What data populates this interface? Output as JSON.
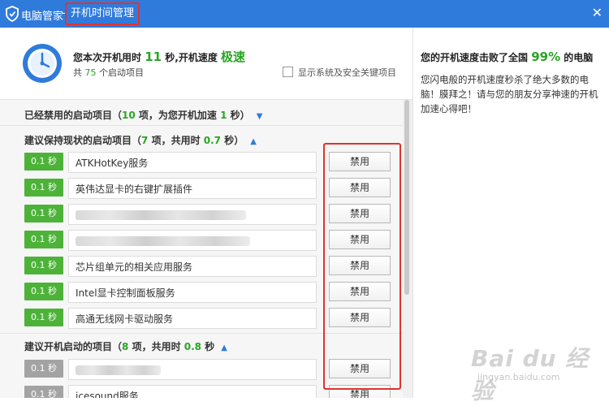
{
  "titlebar": {
    "app_name": "电脑管家",
    "separator": "-",
    "page_title": "开机时间管理",
    "close_icon": "close-icon",
    "logo_icon": "shield-icon"
  },
  "summary": {
    "boot_time_prefix": "您本次开机用时",
    "boot_time_value": "11",
    "boot_time_suffix": "秒,开机速度",
    "speed_word": "极速",
    "items_prefix": "共",
    "items_count": "75",
    "items_suffix": "个启动项目",
    "show_system_label": "显示系统及安全关键项目",
    "show_system_checked": false
  },
  "right_panel": {
    "title_prefix": "您的开机速度击败了全国",
    "percent": "99%",
    "title_suffix": "的电脑",
    "description": "您闪电般的开机速度秒杀了绝大多数的电脑！膜拜之！请与您的朋友分享神速的开机加速心得吧！"
  },
  "sections": {
    "disabled": {
      "prefix": "已经禁用的启动项目（",
      "count": "10",
      "middle": "项，为您开机加速",
      "time": "1",
      "suffix": "秒",
      "chevron": "chevron-down-icon"
    },
    "keep": {
      "prefix": "建议保持现状的启动项目（",
      "count": "7",
      "middle": "项，共用时",
      "time": "0.7",
      "suffix": "秒）",
      "chevron": "chevron-up-icon"
    },
    "recommend": {
      "prefix": "建议开机启动的项目（",
      "count": "8",
      "middle": "项，共用时",
      "time": "0.8",
      "suffix": "秒",
      "chevron": "chevron-up-icon"
    }
  },
  "keep_items": [
    {
      "time": "0.1 秒",
      "name": "ATKHotKey服务",
      "button": "禁用"
    },
    {
      "time": "0.1 秒",
      "name": "英伟达显卡的右键扩展插件",
      "button": "禁用"
    },
    {
      "time": "0.1 秒",
      "name": "",
      "button": "禁用"
    },
    {
      "time": "0.1 秒",
      "name": "",
      "button": "禁用"
    },
    {
      "time": "0.1 秒",
      "name": "芯片组单元的相关应用服务",
      "button": "禁用"
    },
    {
      "time": "0.1 秒",
      "name": "Intel显卡控制面板服务",
      "button": "禁用"
    },
    {
      "time": "0.1 秒",
      "name": "高通无线网卡驱动服务",
      "button": "禁用"
    }
  ],
  "recommend_items": [
    {
      "time": "0.1 秒",
      "name": "",
      "button": "禁用"
    },
    {
      "time": "0.1 秒",
      "name": "icesound服务",
      "button": "禁用"
    }
  ],
  "watermark": {
    "main": "Bai du 经验",
    "sub": "jingyan.baidu.com"
  },
  "colors": {
    "title_bar": "#2f7bdc",
    "accent_green": "#29a523",
    "badge_green": "#4cb338",
    "badge_gray": "#a3a3a3",
    "highlight_red": "#e0332c"
  }
}
